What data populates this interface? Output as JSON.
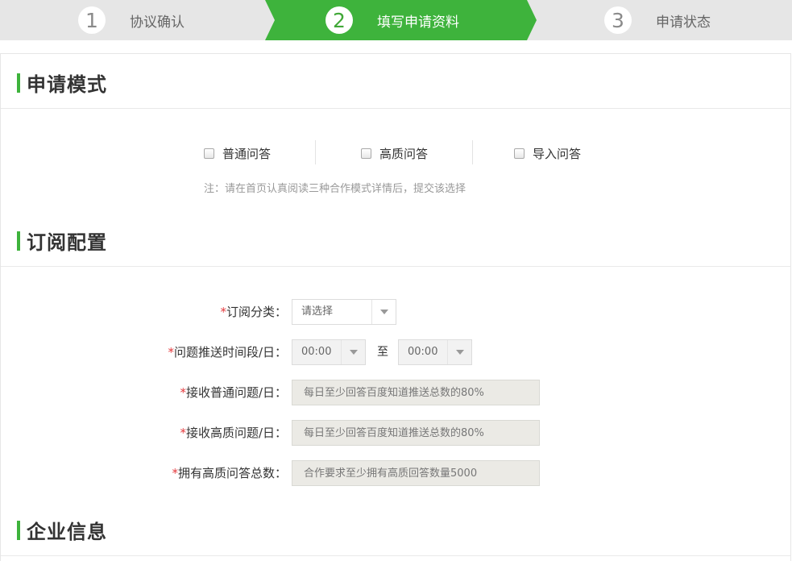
{
  "steps": [
    {
      "num": "1",
      "label": "协议确认"
    },
    {
      "num": "2",
      "label": "填写申请资料"
    },
    {
      "num": "3",
      "label": "申请状态"
    }
  ],
  "colors": {
    "accent": "#3eb33c",
    "step_inactive": "#e6e6e6",
    "required": "#e4393c"
  },
  "sections": {
    "mode": {
      "title": "申请模式"
    },
    "subscription": {
      "title": "订阅配置"
    },
    "company": {
      "title": "企业信息"
    }
  },
  "modes": [
    {
      "label": "普通问答",
      "checked": false
    },
    {
      "label": "高质问答",
      "checked": false
    },
    {
      "label": "导入问答",
      "checked": false
    }
  ],
  "mode_note": "注：请在首页认真阅读三种合作模式详情后，提交该选择",
  "form": {
    "category": {
      "required": "*",
      "label": "订阅分类：",
      "value": "请选择"
    },
    "push_time": {
      "required": "*",
      "label": "问题推送时间段/日：",
      "start": "00:00",
      "to": "至",
      "end": "00:00"
    },
    "normal_questions": {
      "required": "*",
      "label": "接收普通问题/日：",
      "placeholder": "每日至少回答百度知道推送总数的80%"
    },
    "quality_questions": {
      "required": "*",
      "label": "接收高质问题/日：",
      "placeholder": "每日至少回答百度知道推送总数的80%"
    },
    "quality_total": {
      "required": "*",
      "label": "拥有高质问答总数：",
      "placeholder": "合作要求至少拥有高质回答数量5000"
    }
  }
}
